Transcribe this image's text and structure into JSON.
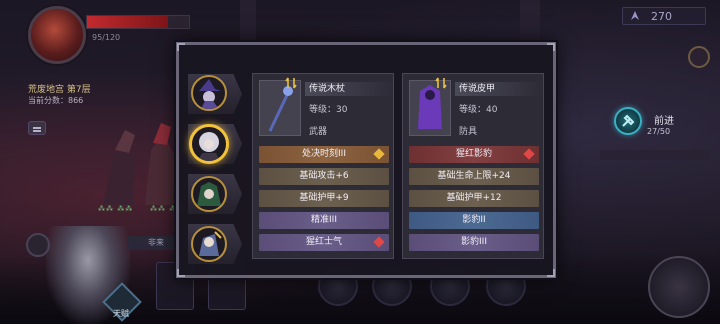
{
  "hud": {
    "hp_text": "95/120",
    "hp_fraction": 0.79,
    "dungeon_name": "荒废地宫 第7层",
    "score": "当前分数：866",
    "currency_value": "270",
    "advance_label": "前进",
    "advance_count": "27/50",
    "skill_label": "天赋",
    "mini_label": "非来",
    "party_hp": [
      "⁂⁂ ⁂⁂",
      "⁂⁂ ⁂⁂"
    ]
  },
  "heroes": [
    {
      "name": "witch",
      "active": false
    },
    {
      "name": "white-haired",
      "active": true
    },
    {
      "name": "green-haired",
      "active": false
    },
    {
      "name": "mage",
      "active": false
    }
  ],
  "weapon": {
    "name": "传说木杖",
    "level": "等级：30",
    "type": "武器",
    "stats": [
      {
        "text": "处决时刻III",
        "style": "orange",
        "gem": "#e8b83c"
      },
      {
        "text": "基础攻击+6",
        "style": "brown",
        "gem": ""
      },
      {
        "text": "基础护甲+9",
        "style": "brown",
        "gem": ""
      },
      {
        "text": "精准III",
        "style": "purple",
        "gem": ""
      },
      {
        "text": "猩红士气",
        "style": "purple",
        "gem": "#e04848"
      }
    ]
  },
  "armor": {
    "name": "传说皮甲",
    "level": "等级：40",
    "type": "防具",
    "stats": [
      {
        "text": "猩红影豹",
        "style": "red",
        "gem": "#e04848"
      },
      {
        "text": "基础生命上限+24",
        "style": "brown",
        "gem": ""
      },
      {
        "text": "基础护甲+12",
        "style": "brown",
        "gem": ""
      },
      {
        "text": "影豹II",
        "style": "blue",
        "gem": ""
      },
      {
        "text": "影豹III",
        "style": "purple",
        "gem": ""
      }
    ]
  },
  "colors": {
    "gold_accent": "#f2c33a",
    "advance_teal": "#3ab0c0"
  }
}
